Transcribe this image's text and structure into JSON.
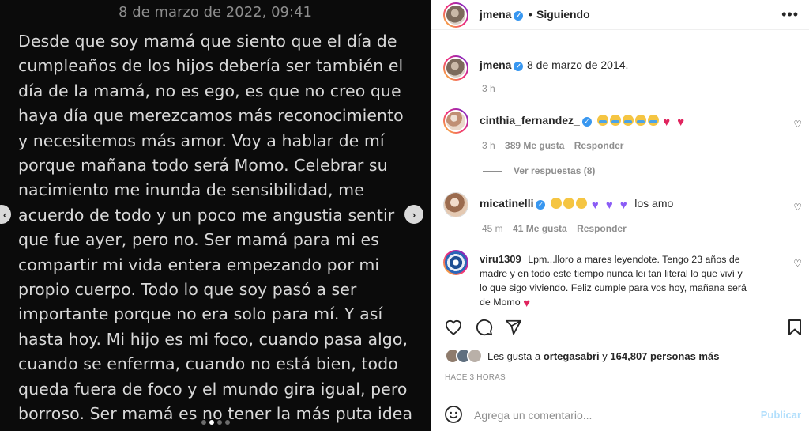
{
  "post_image": {
    "date_header": "8 de marzo de 2022, 09:41",
    "lines": [
      "Desde que soy mamá que siento que el día de",
      "cumpleaños de los hijos debería ser también el",
      "día de la mamá, no es ego, es que no creo que",
      "haya día que merezcamos más reconocimiento",
      "y necesitemos más amor. Voy a hablar de mí",
      "porque mañana todo será Momo. Celebrar su",
      "nacimiento me inunda de sensibilidad, me",
      "acuerdo de todo y un poco me angustia sentir",
      "que fue ayer, pero no. Ser mamá para mi es",
      "compartir mi vida entera empezando por mi",
      "propio cuerpo. Todo lo que soy pasó a ser",
      "importante porque no era solo para mí. Y así",
      "hasta hoy. Mi hijo es mi foco, cuando pasa algo,",
      "cuando se enferma, cuando no está bien, todo",
      "queda fuera de foco y el mundo gira igual, pero",
      "borroso. Ser mamá es no tener la más puta idea"
    ],
    "prev_arrow": "‹",
    "next_arrow": "›"
  },
  "header": {
    "username": "jmena",
    "separator": "•",
    "follow_status": "Siguiendo",
    "more_icon": "•••"
  },
  "caption": {
    "username": "jmena",
    "text": "8 de marzo de 2014.",
    "time": "3 h"
  },
  "comments": [
    {
      "username": "cinthia_fernandez_",
      "emojis": [
        "cry",
        "cry",
        "cry",
        "cry",
        "cry",
        "red",
        "red"
      ],
      "time": "3 h",
      "likes": "389 Me gusta",
      "reply": "Responder",
      "view_replies": "Ver respuestas (8)"
    },
    {
      "username": "micatinelli",
      "emojis": [
        "face",
        "face",
        "face",
        "purple",
        "purple",
        "purple"
      ],
      "text": "los amo",
      "time": "45 m",
      "likes": "41 Me gusta",
      "reply": "Responder"
    },
    {
      "username": "viru1309",
      "text_line1": "Lpm...lloro a mares leyendote. Tengo 23 años de",
      "text_line2": "madre y en todo este tiempo nunca lei tan literal lo que viví y",
      "text_line3": "lo que sigo viviendo. Feliz cumple para vos hoy, mañana será",
      "text_line4": "de Momo"
    }
  ],
  "likes": {
    "prefix": "Les gusta a",
    "user": "ortegasabri",
    "middle": "y",
    "count": "164,807 personas más"
  },
  "time_ago": "HACE 3 HORAS",
  "add_comment": {
    "placeholder": "Agrega un comentario...",
    "publish": "Publicar"
  },
  "colors": {
    "verified": "#3897f0",
    "publish_disabled": "#b2dffc",
    "heart": "#e0245e"
  }
}
